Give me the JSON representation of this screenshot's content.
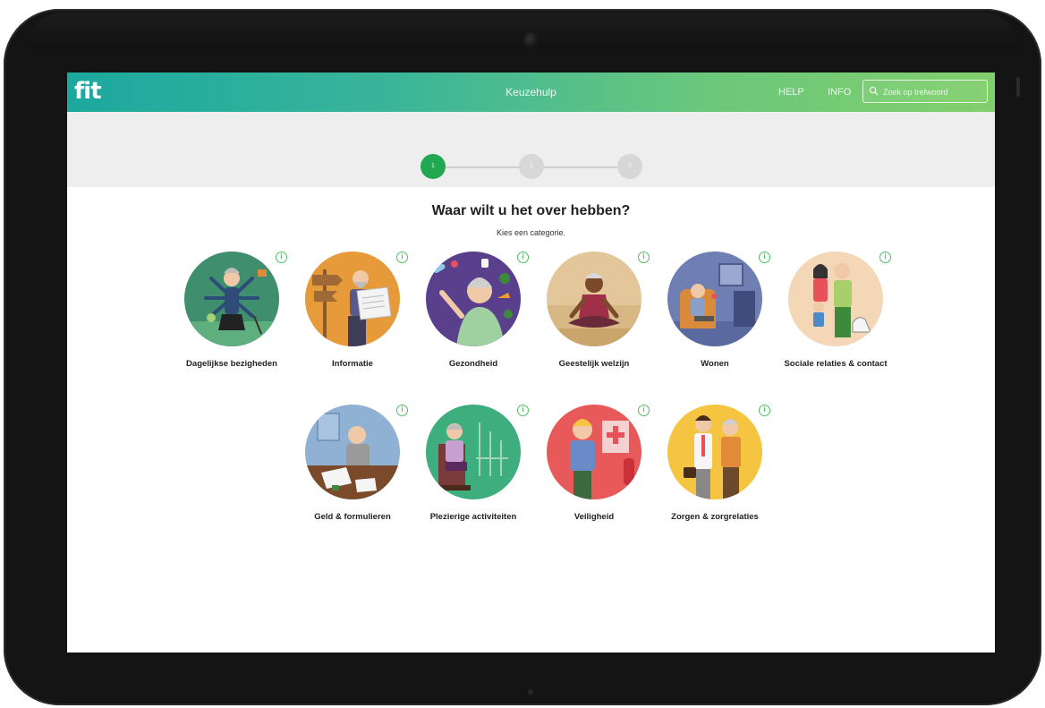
{
  "header": {
    "logo": "fit",
    "title": "Keuzehulp",
    "help_label": "HELP",
    "info_label": "INFO",
    "search_placeholder": "Zoek op trefwoord"
  },
  "stepper": {
    "steps": [
      "1",
      "2",
      "3"
    ],
    "active_step": 1
  },
  "main": {
    "heading": "Waar wilt u het over hebben?",
    "subheading": "Kies een categorie."
  },
  "categories": [
    {
      "label": "Dagelijkse bezigheden",
      "icon": "person-many-arms-illustration",
      "color": "#3f8e6e"
    },
    {
      "label": "Informatie",
      "icon": "man-reading-newspaper-illustration",
      "color": "#e69a3a"
    },
    {
      "label": "Gezondheid",
      "icon": "woman-with-food-illustration",
      "color": "#5a3f8c"
    },
    {
      "label": "Geestelijk welzijn",
      "icon": "person-meditating-illustration",
      "color": "#e3c79a"
    },
    {
      "label": "Wonen",
      "icon": "man-in-armchair-illustration",
      "color": "#6f7fb3"
    },
    {
      "label": "Sociale relaties & contact",
      "icon": "family-with-dog-illustration",
      "color": "#f3d7b6"
    },
    {
      "label": "Geld & formulieren",
      "icon": "man-at-desk-illustration",
      "color": "#8fb2d4"
    },
    {
      "label": "Plezierige activiteiten",
      "icon": "woman-in-chair-illustration",
      "color": "#3fae7e"
    },
    {
      "label": "Veiligheid",
      "icon": "man-with-fire-extinguisher-illustration",
      "color": "#e85a5a"
    },
    {
      "label": "Zorgen & zorgrelaties",
      "icon": "caregiver-and-elder-illustration",
      "color": "#f5c440"
    }
  ],
  "colors": {
    "accent": "#22a850",
    "topbar_start": "#1ca89f",
    "topbar_end": "#81cf6b"
  }
}
